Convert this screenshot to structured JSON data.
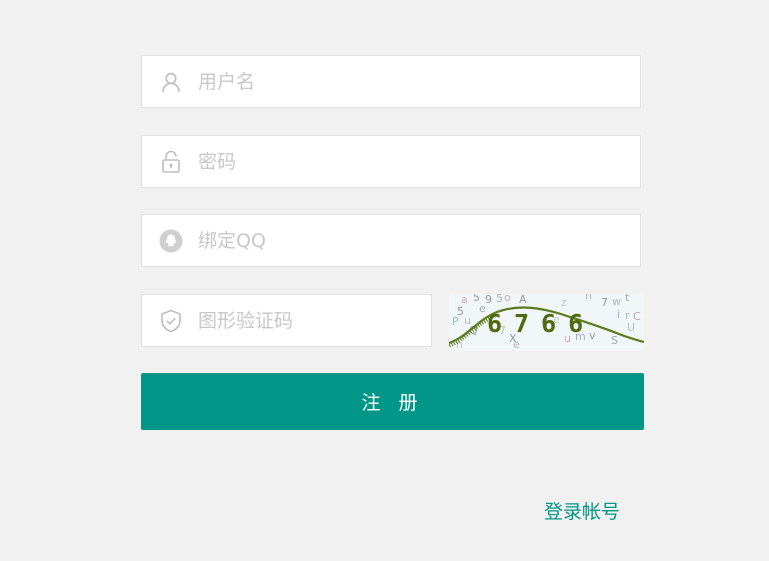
{
  "form": {
    "username": {
      "placeholder": "用户名",
      "value": ""
    },
    "password": {
      "placeholder": "密码",
      "value": ""
    },
    "qq": {
      "placeholder": "绑定QQ",
      "value": ""
    },
    "captcha": {
      "placeholder": "图形验证码",
      "value": "",
      "image_text": "6766"
    },
    "submit_label": "注 册",
    "login_link_label": "登录帐号"
  },
  "colors": {
    "accent": "#009688",
    "background": "#f1f1f1",
    "border": "#e2e2e2",
    "placeholder": "#c8c8c8",
    "icon": "#bdbdbd"
  },
  "icons": [
    "user-icon",
    "lock-icon",
    "qq-icon",
    "shield-check-icon"
  ]
}
